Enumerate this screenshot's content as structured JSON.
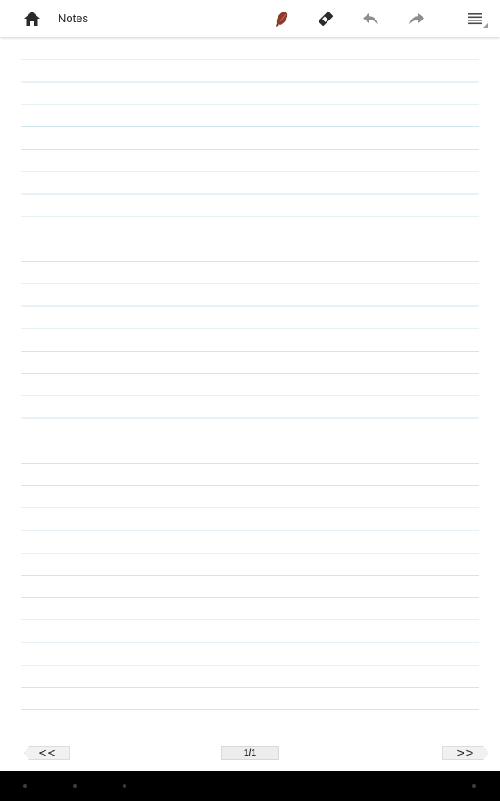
{
  "header": {
    "title": "Notes",
    "icons": {
      "home": "home-icon",
      "pen": "pen-icon",
      "eraser": "eraser-icon",
      "undo": "undo-icon",
      "redo": "redo-icon",
      "menu": "menu-icon"
    },
    "pen_color": "#8b3a2b"
  },
  "pager": {
    "prev_label": "<<",
    "next_label": ">>",
    "page_indicator": "1/1"
  },
  "paper": {
    "line_color": "#cfe6ec"
  },
  "system_bar": {
    "icons": [
      "back-icon",
      "home-icon",
      "recent-apps-icon",
      "menu-icon"
    ]
  }
}
